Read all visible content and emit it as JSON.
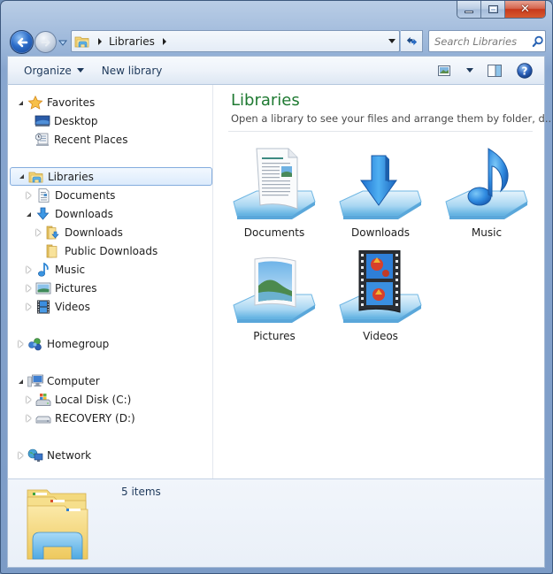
{
  "window": {
    "title": "Libraries",
    "caption_buttons": {
      "minimize": "minimize",
      "maximize": "maximize",
      "close": "close"
    }
  },
  "navigation": {
    "back_icon": "back-arrow-icon",
    "forward_icon": "forward-arrow-icon",
    "breadcrumb": [
      "Libraries"
    ],
    "search_placeholder": "Search Libraries"
  },
  "toolbar": {
    "organize_label": "Organize",
    "new_library_label": "New library"
  },
  "nav_pane": {
    "items": [
      {
        "label": "Favorites",
        "icon": "star-icon",
        "level": 0,
        "expander": "open"
      },
      {
        "label": "Desktop",
        "icon": "desktop-icon",
        "level": 1,
        "expander": "none"
      },
      {
        "label": "Recent Places",
        "icon": "recent-places-icon",
        "level": 1,
        "expander": "none"
      },
      {
        "label": "Libraries",
        "icon": "libraries-icon",
        "level": 0,
        "expander": "open",
        "selected": true
      },
      {
        "label": "Documents",
        "icon": "documents-icon",
        "level": 1,
        "expander": "closed"
      },
      {
        "label": "Downloads",
        "icon": "downloads-icon",
        "level": 1,
        "expander": "open"
      },
      {
        "label": "Downloads",
        "icon": "downloads-folder-icon",
        "level": 2,
        "expander": "closed"
      },
      {
        "label": "Public Downloads",
        "icon": "folder-icon",
        "level": 2,
        "expander": "none"
      },
      {
        "label": "Music",
        "icon": "music-icon",
        "level": 1,
        "expander": "closed"
      },
      {
        "label": "Pictures",
        "icon": "pictures-icon",
        "level": 1,
        "expander": "closed"
      },
      {
        "label": "Videos",
        "icon": "videos-icon",
        "level": 1,
        "expander": "closed"
      },
      {
        "label": "Homegroup",
        "icon": "homegroup-icon",
        "level": 0,
        "expander": "closed"
      },
      {
        "label": "Computer",
        "icon": "computer-icon",
        "level": 0,
        "expander": "open"
      },
      {
        "label": "Local Disk (C:)",
        "icon": "local-disk-icon",
        "level": 1,
        "expander": "closed"
      },
      {
        "label": "RECOVERY (D:)",
        "icon": "drive-icon",
        "level": 1,
        "expander": "closed"
      },
      {
        "label": "Network",
        "icon": "network-icon",
        "level": 0,
        "expander": "closed"
      }
    ]
  },
  "content": {
    "title": "Libraries",
    "subtitle": "Open a library to see your files and arrange them by folder, d...",
    "libraries": [
      {
        "label": "Documents",
        "icon": "documents-library-icon"
      },
      {
        "label": "Downloads",
        "icon": "downloads-library-icon"
      },
      {
        "label": "Music",
        "icon": "music-library-icon"
      },
      {
        "label": "Pictures",
        "icon": "pictures-library-icon"
      },
      {
        "label": "Videos",
        "icon": "videos-library-icon"
      }
    ]
  },
  "details": {
    "item_count": "5 items"
  },
  "colors": {
    "title_green": "#1f7a32",
    "selection_border": "#84acdd",
    "chrome_blue": "#7c9bc6",
    "close_red": "#c7391c"
  }
}
